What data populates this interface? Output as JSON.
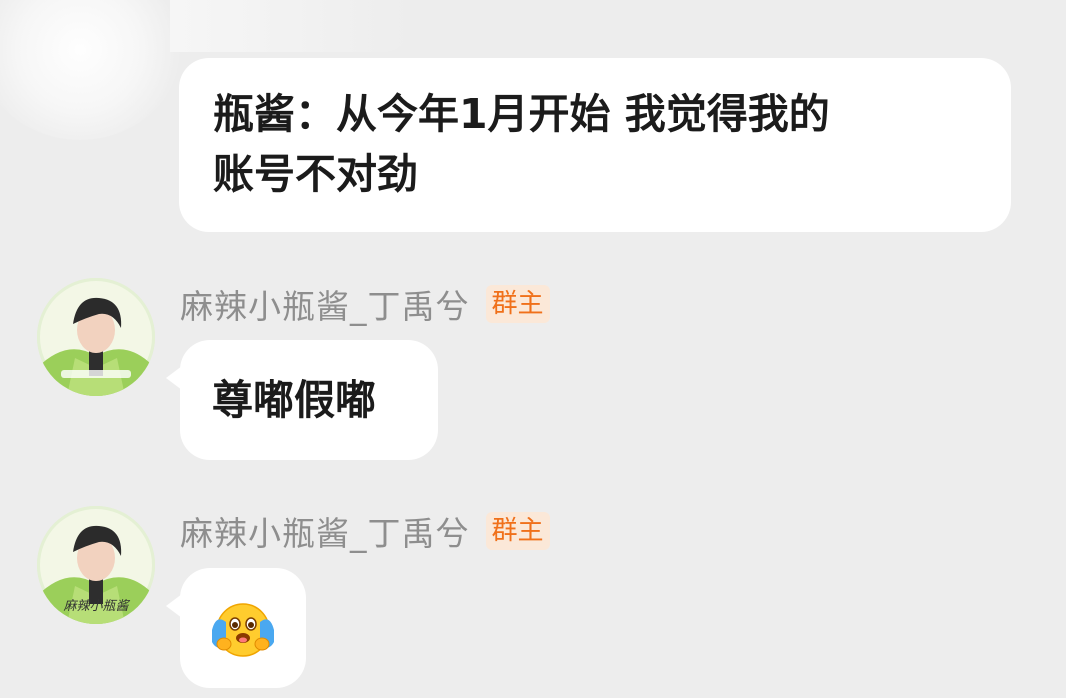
{
  "messages": [
    {
      "text_line1": "瓶酱：从今年1月开始 我觉得我的",
      "text_line2": "账号不对劲"
    },
    {
      "sender": "麻辣小瓶酱_丁禹兮",
      "role_badge": "群主",
      "text": "尊嘟假嘟"
    },
    {
      "sender": "麻辣小瓶酱_丁禹兮",
      "role_badge": "群主",
      "emoji": "crying-hugging-face-emoji"
    }
  ],
  "avatar_watermark": "麻辣小瓶酱",
  "colors": {
    "background": "#ededed",
    "bubble": "#ffffff",
    "sender_name": "#8e8e8e",
    "badge_bg": "#fbe8d8",
    "badge_text": "#f0701a"
  }
}
